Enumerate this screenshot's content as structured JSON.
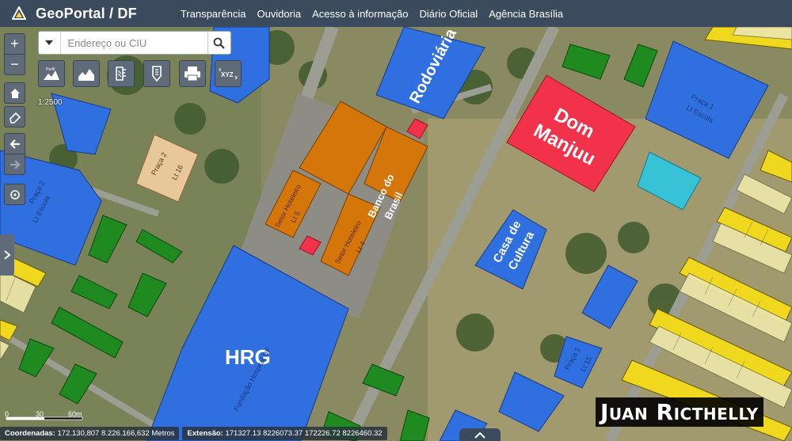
{
  "header": {
    "brand": "GeoPortal / DF",
    "nav": [
      "Transparência",
      "Ouvidoria",
      "Acesso à informação",
      "Diário Oficial",
      "Agência Brasília"
    ]
  },
  "search": {
    "placeholder": "Endereço ou CIU"
  },
  "toolbar": {
    "zoom_in": "+",
    "zoom_out": "−",
    "tools": [
      {
        "name": "profile-tool-button",
        "label": "Perfil",
        "icon": "elevation-profile-icon"
      },
      {
        "name": "terrain-tool-button",
        "label": "",
        "icon": "terrain-icon"
      },
      {
        "name": "measure-tool-button",
        "label": "",
        "icon": "ruler-icon"
      },
      {
        "name": "locate-tool-button",
        "label": "",
        "icon": "map-pin-icon"
      },
      {
        "name": "print-button",
        "label": "",
        "icon": "printer-icon"
      },
      {
        "name": "xyz-button",
        "label": "XYZ",
        "icon": "xyz-coordinates-icon"
      }
    ]
  },
  "map": {
    "scale_text": "1:2500",
    "labels": {
      "rodoviaria": "Rodoviária",
      "dom_manjuu_1": "Dom",
      "dom_manjuu_2": "Manjuu",
      "banco_1": "Banco do",
      "banco_2": "Brasil",
      "casa_1": "Casa de",
      "casa_2": "Cultura",
      "hrg": "HRG",
      "praca2_lt": "Praça 2\nLt 16",
      "praca2_left": "Praça 2\nLt Escola",
      "praca1_right": "Praça 1\nLt Escola",
      "praca1_low": "Praça 1\nLt 15",
      "setor_a": "Setor Hoteleiro\nLt 5",
      "setor_b": "Setor Hoteleiro\nLt 4",
      "hospital": "Fundação Hospital DF"
    },
    "colors": {
      "blue": "#2f6fe0",
      "orange": "#d4760a",
      "red": "#f2324a",
      "cyan": "#38c2d8",
      "green": "#1f8a1f",
      "yellow": "#f0d81e",
      "tan": "#e8c79a"
    }
  },
  "scalebar": {
    "ticks": [
      "0",
      "30",
      "60m"
    ]
  },
  "status": {
    "coords_label": "Coordenadas:",
    "coords_value": "172.130,807 8.226.166,632 Metros",
    "extent_label": "Extensão:",
    "extent_value": "171327.13 8226073.37 172226.72 8226460.32"
  },
  "watermark": "Juan Ricthelly"
}
